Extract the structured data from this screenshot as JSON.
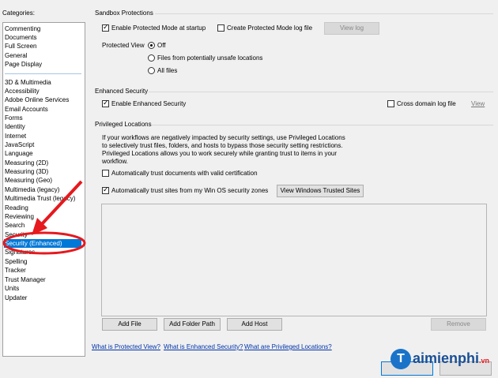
{
  "categories_label": "Categories:",
  "categories_top": [
    "Commenting",
    "Documents",
    "Full Screen",
    "General",
    "Page Display"
  ],
  "categories_bottom": [
    "3D & Multimedia",
    "Accessibility",
    "Adobe Online Services",
    "Email Accounts",
    "Forms",
    "Identity",
    "Internet",
    "JavaScript",
    "Language",
    "Measuring (2D)",
    "Measuring (3D)",
    "Measuring (Geo)",
    "Multimedia (legacy)",
    "Multimedia Trust (legacy)",
    "Reading",
    "Reviewing",
    "Search",
    "Security",
    "Security (Enhanced)",
    "Signatures",
    "Spelling",
    "Tracker",
    "Trust Manager",
    "Units",
    "Updater"
  ],
  "selected_category": "Security (Enhanced)",
  "sandbox": {
    "title": "Sandbox Protections",
    "enable_protected_mode": "Enable Protected Mode at startup",
    "create_log": "Create Protected Mode log file",
    "view_log": "View log",
    "protected_view_label": "Protected View",
    "opt_off": "Off",
    "opt_unsafe": "Files from potentially unsafe locations",
    "opt_all": "All files"
  },
  "enhanced": {
    "title": "Enhanced Security",
    "enable": "Enable Enhanced Security",
    "cross_domain": "Cross domain log file",
    "view": "View"
  },
  "privileged": {
    "title": "Privileged Locations",
    "desc": "If your workflows are negatively impacted by security settings, use Privileged Locations to selectively trust files, folders, and hosts to bypass those security setting restrictions. Privileged Locations allows you to work securely while granting trust to items in your workflow.",
    "auto_cert": "Automatically trust documents with valid certification",
    "auto_sites": "Automatically trust sites from my Win OS security zones",
    "view_trusted": "View Windows Trusted Sites",
    "add_file": "Add File",
    "add_folder": "Add Folder Path",
    "add_host": "Add Host",
    "remove": "Remove"
  },
  "links": {
    "protected_view": "What is Protected View?",
    "enhanced_security": "What is Enhanced Security?",
    "privileged_locations": "What are Privileged Locations?"
  },
  "watermark": {
    "text": "aimienphi",
    "suffix": ".vn"
  },
  "colors": {
    "selection": "#0078d7",
    "annotation_red": "#e5191e"
  }
}
